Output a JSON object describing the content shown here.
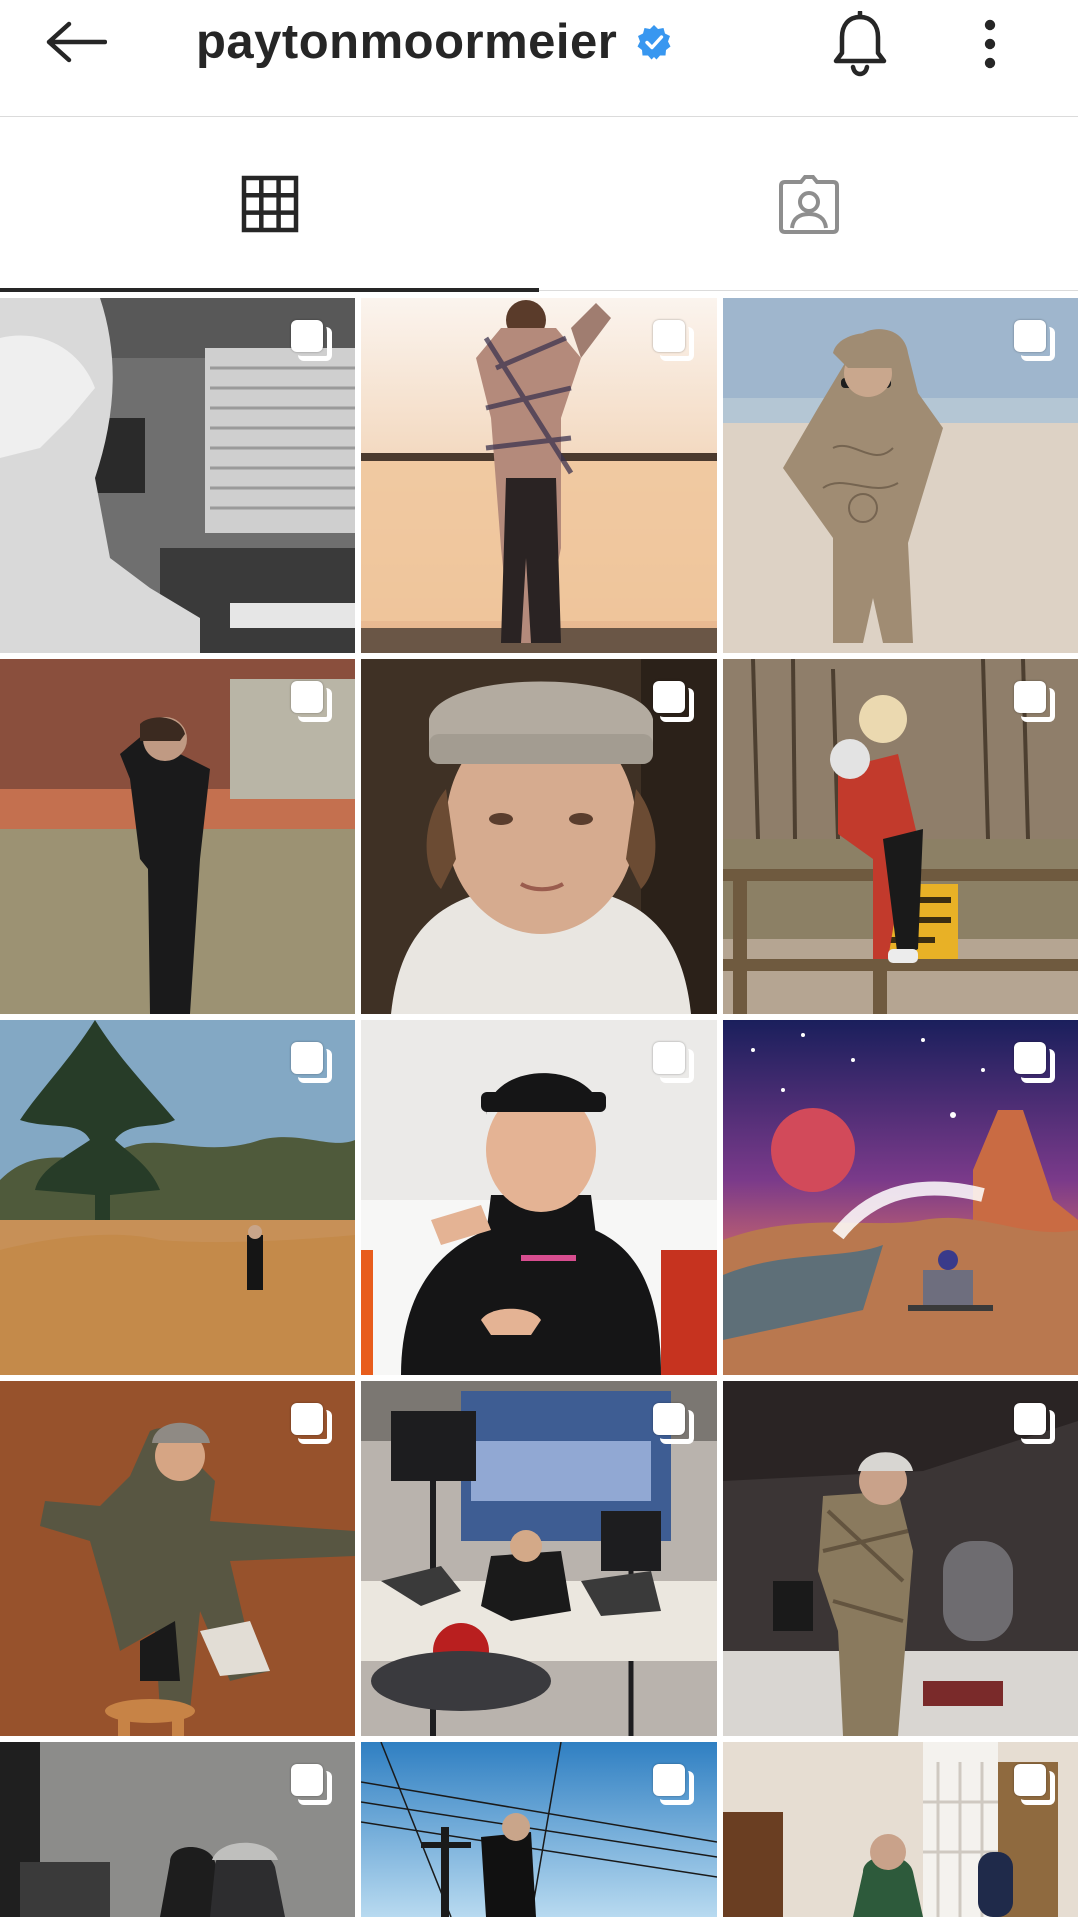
{
  "header": {
    "username": "paytonmoormeier",
    "back_icon": "arrow-left-icon",
    "verified_icon": "verified-badge-icon",
    "notifications_icon": "bell-icon",
    "more_icon": "more-vertical-icon",
    "colors": {
      "verified": "#3897f0",
      "text": "#262626"
    }
  },
  "tabs": [
    {
      "name": "posts-grid",
      "icon": "grid-icon",
      "active": true
    },
    {
      "name": "tagged",
      "icon": "tagged-user-icon",
      "active": false
    }
  ],
  "grid": {
    "multi_post_icon": "multiple-posts-icon",
    "posts": [
      {
        "scene": "bw-piano-room"
      },
      {
        "scene": "sunset-lake-plaid"
      },
      {
        "scene": "beach-hoodie"
      },
      {
        "scene": "field-black-tracksuit"
      },
      {
        "scene": "beanie-selfie"
      },
      {
        "scene": "railing-red-tiedye"
      },
      {
        "scene": "pine-field-wide"
      },
      {
        "scene": "backward-cap-pointing"
      },
      {
        "scene": "desert-night-art"
      },
      {
        "scene": "studio-stool-pose"
      },
      {
        "scene": "young-hollywood-set"
      },
      {
        "scene": "recording-studio"
      },
      {
        "scene": "friends-indoor"
      },
      {
        "scene": "powerlines-sky"
      },
      {
        "scene": "living-room-chair"
      }
    ]
  }
}
